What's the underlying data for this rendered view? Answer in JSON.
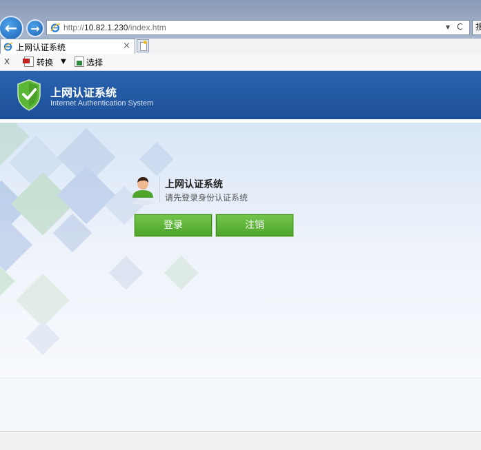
{
  "browser": {
    "url_prefix": "http://",
    "url_host": "10.82.1.230",
    "url_path": "/index.htm",
    "refresh_glyph": "C",
    "dropdown_glyph": "▾",
    "right_stub_text": "搜",
    "back_glyph": "←",
    "forward_glyph": "→",
    "tab": {
      "title": "上网认证系统",
      "close_glyph": "×"
    },
    "toolbar": {
      "close_glyph": "x",
      "convert_label": "转换",
      "dropdown_glyph": "▼",
      "select_label": "选择"
    },
    "icons": [
      "ie-icon",
      "back-arrow-icon",
      "forward-arrow-icon",
      "refresh-icon",
      "pdf-convert-icon",
      "select-icon",
      "new-tab-icon"
    ]
  },
  "header": {
    "title": "上网认证系统",
    "subtitle": "Internet Authentication System",
    "logo": "shield-check-icon",
    "bg_color": "#2459a6"
  },
  "login_panel": {
    "title": "上网认证系统",
    "subtitle": "请先登录身份认证系统",
    "avatar": "user-icon",
    "login_button": "登录",
    "logout_button": "注销",
    "button_color": "#5cb335"
  }
}
